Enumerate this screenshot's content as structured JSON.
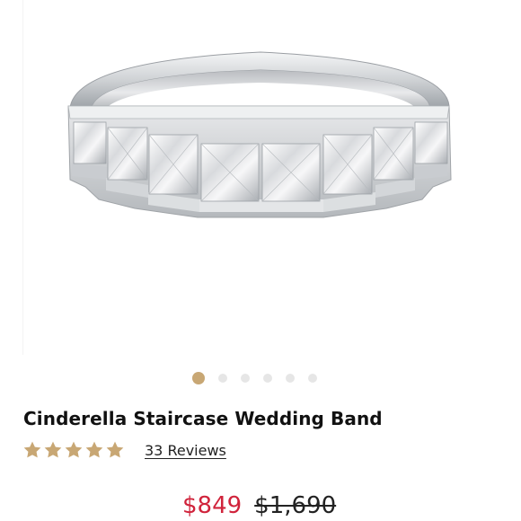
{
  "product": {
    "title": "Cinderella Staircase Wedding Band",
    "image_icon": "wedding-band-image",
    "rating": {
      "value": 5,
      "max": 5,
      "reviews_label": "33 Reviews",
      "star_color": "#c8a774"
    },
    "price": {
      "sale": "$849",
      "original": "$1,690",
      "sale_color": "#d0233b"
    }
  },
  "gallery": {
    "slide_count": 6,
    "active_index": 0,
    "active_color": "#c8a774",
    "inactive_color": "#e6e6e6"
  }
}
